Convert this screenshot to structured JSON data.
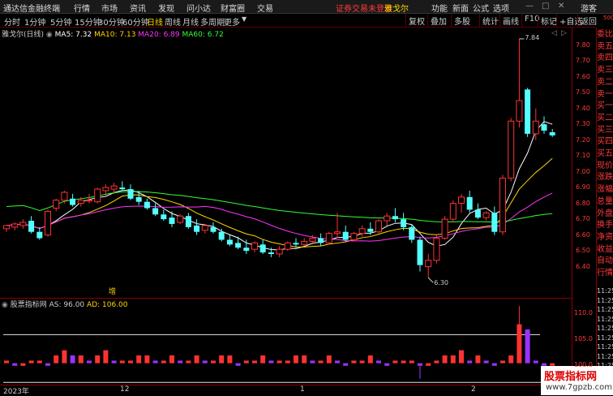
{
  "titlebar": {
    "app_name": "通达信金融终端",
    "menus": [
      "行情",
      "市场",
      "资讯",
      "发现",
      "问小达",
      "财富圈",
      "交易"
    ],
    "warning": "证券交易未登录",
    "stock_short": "雅戈尔",
    "right_menus": [
      "功能",
      "新面",
      "公式",
      "选项"
    ],
    "guest": "游客"
  },
  "periods": [
    "分时",
    "1分钟",
    "5分钟",
    "15分钟",
    "30分钟",
    "60分钟",
    "日线",
    "周线",
    "月线",
    "多周期",
    "更多"
  ],
  "active_period": "日线",
  "toolbar": [
    "复权",
    "叠加",
    "多股",
    "统计",
    "画线",
    "F10",
    "标记",
    "+自选",
    "返回"
  ],
  "main": {
    "stock_title": "雅戈尔(日线)",
    "ma_legend": [
      {
        "label": "MA5: 7.32",
        "color": "#ffffff"
      },
      {
        "label": "MA10: 7.13",
        "color": "#ffd700"
      },
      {
        "label": "MA20: 6.89",
        "color": "#ff33ff"
      },
      {
        "label": "MA60: 6.72",
        "color": "#33ff33"
      }
    ],
    "high_label": "7.84",
    "low_label": "6.30",
    "event_marker": "增",
    "y_ticks": [
      "7.80",
      "7.70",
      "7.60",
      "7.50",
      "7.40",
      "7.30",
      "7.20",
      "7.10",
      "7.00",
      "6.90",
      "6.80",
      "6.70",
      "6.60",
      "6.50",
      "6.40"
    ]
  },
  "indicator": {
    "name": "股票指标网",
    "as_label": "AS: 96.00",
    "ad_label": "AD: 106.00",
    "y_ticks": [
      "110.0",
      "105.0",
      "100.0"
    ]
  },
  "side_labels": [
    "委比",
    "卖五",
    "卖四",
    "卖三",
    "卖二",
    "卖一",
    "买一",
    "买二",
    "买三",
    "买四",
    "买五",
    "现价",
    "涨跌",
    "涨幅",
    "总量",
    "外盘",
    "换手",
    "净资",
    "收益",
    "自动",
    "行情"
  ],
  "side_times": [
    "11:25",
    "11:25",
    "11:25",
    "11:25",
    "11:25",
    "11:25",
    "11:25",
    "11:25",
    "11:25",
    "11:25",
    "11:25"
  ],
  "side_top_label": "500",
  "x_ticks": [
    "2023年",
    "12",
    "1",
    "2"
  ],
  "watermark": {
    "line1": "股票指标网",
    "line2": "www.7gpzb.com"
  },
  "chart_data": {
    "type": "candlestick",
    "price_range": [
      6.28,
      7.86
    ],
    "candles": [
      [
        6.64,
        6.66,
        6.62,
        6.66
      ],
      [
        6.65,
        6.68,
        6.63,
        6.67
      ],
      [
        6.66,
        6.7,
        6.64,
        6.68
      ],
      [
        6.69,
        6.72,
        6.61,
        6.62
      ],
      [
        6.62,
        6.65,
        6.57,
        6.58
      ],
      [
        6.6,
        6.76,
        6.59,
        6.75
      ],
      [
        6.77,
        6.83,
        6.75,
        6.82
      ],
      [
        6.82,
        6.88,
        6.8,
        6.87
      ],
      [
        6.83,
        6.86,
        6.78,
        6.79
      ],
      [
        6.8,
        6.84,
        6.78,
        6.82
      ],
      [
        6.82,
        6.86,
        6.8,
        6.82
      ],
      [
        6.81,
        6.9,
        6.8,
        6.89
      ],
      [
        6.88,
        6.92,
        6.85,
        6.9
      ],
      [
        6.89,
        6.93,
        6.86,
        6.91
      ],
      [
        6.9,
        6.94,
        6.88,
        6.89
      ],
      [
        6.89,
        6.92,
        6.82,
        6.83
      ],
      [
        6.84,
        6.88,
        6.79,
        6.81
      ],
      [
        6.81,
        6.83,
        6.76,
        6.77
      ],
      [
        6.77,
        6.8,
        6.72,
        6.73
      ],
      [
        6.73,
        6.76,
        6.69,
        6.7
      ],
      [
        6.71,
        6.75,
        6.65,
        6.67
      ],
      [
        6.68,
        6.73,
        6.67,
        6.72
      ],
      [
        6.72,
        6.74,
        6.64,
        6.65
      ],
      [
        6.66,
        6.7,
        6.6,
        6.62
      ],
      [
        6.63,
        6.67,
        6.61,
        6.66
      ],
      [
        6.65,
        6.68,
        6.61,
        6.62
      ],
      [
        6.62,
        6.64,
        6.56,
        6.57
      ],
      [
        6.57,
        6.6,
        6.53,
        6.54
      ],
      [
        6.55,
        6.59,
        6.51,
        6.52
      ],
      [
        6.52,
        6.57,
        6.48,
        6.5
      ],
      [
        6.51,
        6.56,
        6.49,
        6.55
      ],
      [
        6.54,
        6.57,
        6.48,
        6.49
      ],
      [
        6.49,
        6.52,
        6.46,
        6.48
      ],
      [
        6.48,
        6.53,
        6.46,
        6.51
      ],
      [
        6.51,
        6.56,
        6.5,
        6.55
      ],
      [
        6.55,
        6.58,
        6.52,
        6.54
      ],
      [
        6.54,
        6.58,
        6.53,
        6.56
      ],
      [
        6.56,
        6.6,
        6.54,
        6.58
      ],
      [
        6.58,
        6.61,
        6.53,
        6.55
      ],
      [
        6.55,
        6.62,
        6.54,
        6.61
      ],
      [
        6.61,
        6.74,
        6.58,
        6.62
      ],
      [
        6.62,
        6.66,
        6.56,
        6.57
      ],
      [
        6.57,
        6.62,
        6.56,
        6.61
      ],
      [
        6.61,
        6.66,
        6.59,
        6.64
      ],
      [
        6.64,
        6.68,
        6.6,
        6.62
      ],
      [
        6.62,
        6.7,
        6.61,
        6.69
      ],
      [
        6.69,
        6.74,
        6.66,
        6.72
      ],
      [
        6.72,
        6.77,
        6.68,
        6.7
      ],
      [
        6.7,
        6.74,
        6.63,
        6.65
      ],
      [
        6.65,
        6.67,
        6.55,
        6.57
      ],
      [
        6.57,
        6.59,
        6.37,
        6.41
      ],
      [
        6.4,
        6.48,
        6.33,
        6.44
      ],
      [
        6.44,
        6.6,
        6.42,
        6.58
      ],
      [
        6.58,
        6.72,
        6.57,
        6.7
      ],
      [
        6.7,
        6.82,
        6.68,
        6.8
      ],
      [
        6.8,
        6.86,
        6.74,
        6.84
      ],
      [
        6.84,
        6.88,
        6.74,
        6.76
      ],
      [
        6.76,
        6.8,
        6.7,
        6.71
      ],
      [
        6.71,
        6.75,
        6.69,
        6.74
      ],
      [
        6.74,
        6.78,
        6.6,
        6.62
      ],
      [
        6.62,
        6.98,
        6.6,
        6.96
      ],
      [
        6.96,
        7.34,
        6.94,
        7.32
      ],
      [
        7.32,
        7.84,
        7.28,
        7.45
      ],
      [
        7.52,
        7.53,
        7.22,
        7.24
      ],
      [
        7.24,
        7.4,
        7.2,
        7.32
      ],
      [
        7.3,
        7.35,
        7.24,
        7.26
      ],
      [
        7.25,
        7.27,
        7.22,
        7.23
      ]
    ],
    "as_values": [
      101,
      100,
      100,
      101,
      101,
      100,
      102,
      103,
      102,
      102,
      101,
      102,
      103,
      101,
      101,
      101,
      102,
      102,
      101,
      101,
      102,
      101,
      101,
      102,
      101,
      101,
      102,
      102,
      100,
      101,
      101,
      102,
      101,
      101,
      101,
      102,
      102,
      101,
      101,
      102,
      101,
      100,
      101,
      101,
      102,
      101,
      100,
      101,
      101,
      101,
      100,
      100,
      101,
      102,
      102,
      103,
      101,
      102,
      101,
      100,
      101,
      102,
      108,
      107,
      101,
      100,
      100
    ]
  }
}
